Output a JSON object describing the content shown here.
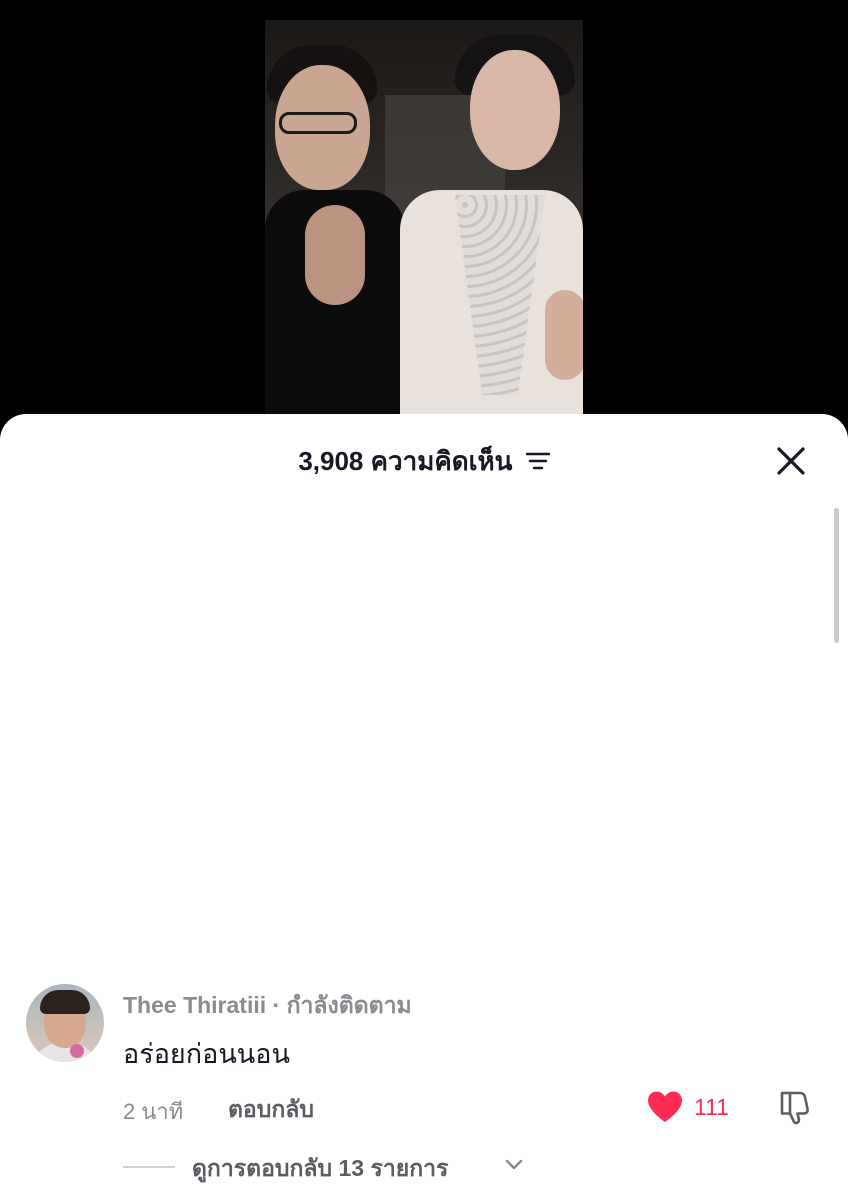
{
  "header": {
    "comment_count": "3,908",
    "comment_label": "ความคิดเห็น",
    "filter_icon": "sort-filter-icon",
    "close_icon": "close-icon"
  },
  "comment": {
    "username": "Thee Thiratiii",
    "separator": "·",
    "follow_status": "กำลังติดตาม",
    "text": "อร่อยก่อนนอน",
    "time": "2 นาที",
    "reply_label": "ตอบกลับ",
    "like_count": "111",
    "view_replies_label": "ดูการตอบกลับ 13 รายการ",
    "like_icon": "heart-icon",
    "dislike_icon": "thumbs-down-icon"
  },
  "colors": {
    "like_red": "#fe2c55",
    "text_primary": "#161823",
    "text_secondary": "#8a8b91"
  }
}
